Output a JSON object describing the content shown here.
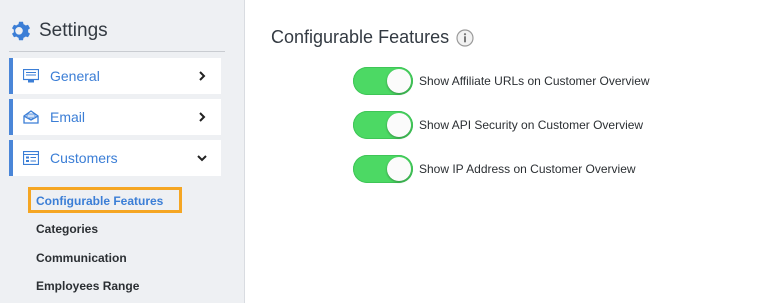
{
  "sidebar": {
    "title": "Settings",
    "nav": [
      {
        "label": "General",
        "icon": "monitor-icon",
        "state": "collapsed"
      },
      {
        "label": "Email",
        "icon": "envelope-icon",
        "state": "collapsed"
      },
      {
        "label": "Customers",
        "icon": "list-icon",
        "state": "expanded"
      }
    ],
    "subitems": [
      {
        "label": "Configurable Features",
        "active": true
      },
      {
        "label": "Categories"
      },
      {
        "label": "Communication"
      },
      {
        "label": "Employees Range"
      }
    ]
  },
  "main": {
    "title": "Configurable Features",
    "toggles": [
      {
        "label": "Show Affiliate URLs on Customer Overview",
        "on": true
      },
      {
        "label": "Show API Security on Customer Overview",
        "on": true
      },
      {
        "label": "Show IP Address on Customer Overview",
        "on": true
      }
    ]
  },
  "colors": {
    "accent": "#3b7ed6",
    "toggle_on": "#4cd964",
    "highlight": "#f5a623"
  }
}
